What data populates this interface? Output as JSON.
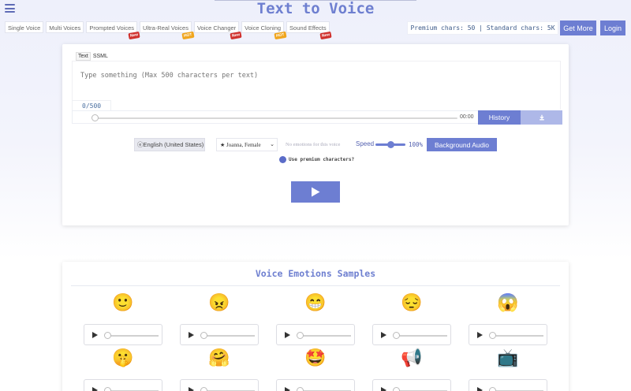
{
  "header": {
    "title": "Text to Voice",
    "chars_info": "Premium chars: 50 | Standard chars: 5K",
    "get_more_label": "Get More",
    "login_label": "Login"
  },
  "tabs": [
    {
      "label": "Single Voice",
      "badge": ""
    },
    {
      "label": "Multi Voices",
      "badge": ""
    },
    {
      "label": "Prompted Voices",
      "badge": "New"
    },
    {
      "label": "Ultra-Real Voices",
      "badge": "HOT"
    },
    {
      "label": "Voice Changer",
      "badge": "New"
    },
    {
      "label": "Voice Cloning",
      "badge": "HOT"
    },
    {
      "label": "Sound Effects",
      "badge": "New"
    }
  ],
  "editor": {
    "mode_tabs": [
      "Text",
      "SSML"
    ],
    "placeholder": "Type something (Max 500 characters per text)",
    "counter": "0/500",
    "time": "00:00",
    "history_label": "History"
  },
  "controls": {
    "language": "ⓔEnglish (United States)",
    "voice": "★ Joanna, Female",
    "emotion": "No emotions for this voice",
    "speed_label": "Speed",
    "speed_value": "100%",
    "speed_fraction": 0.5,
    "background_audio_label": "Background Audio",
    "premium_label": "Use premium characters?"
  },
  "samples": {
    "title": "Voice Emotions Samples",
    "items": [
      {
        "emoji": "🙂",
        "icon": "smiling-face-icon"
      },
      {
        "emoji": "😠",
        "icon": "angry-face-icon"
      },
      {
        "emoji": "😁",
        "icon": "grinning-face-icon"
      },
      {
        "emoji": "😔",
        "icon": "pensive-face-icon"
      },
      {
        "emoji": "😱",
        "icon": "screaming-face-icon"
      },
      {
        "emoji": "🤫",
        "icon": "shushing-face-icon"
      },
      {
        "emoji": "🤗",
        "icon": "hugging-face-icon"
      },
      {
        "emoji": "🤩",
        "icon": "star-struck-face-icon"
      },
      {
        "emoji": "📢",
        "icon": "loudspeaker-icon"
      },
      {
        "emoji": "📺",
        "icon": "television-icon"
      }
    ]
  },
  "colors": {
    "accent": "#6d7ed2",
    "title": "#6e7fd0",
    "badge_new": "#d0312d",
    "badge_hot": "#f0a51c"
  }
}
